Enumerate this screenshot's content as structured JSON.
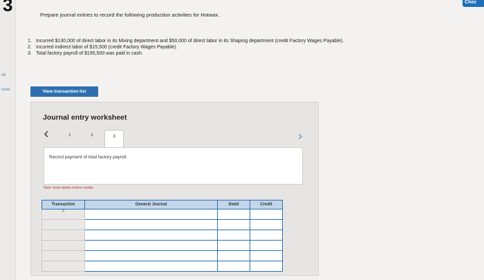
{
  "app": {
    "big_digit": "3",
    "side_labels": [
      "ok",
      "nces"
    ],
    "check_button": "Chec"
  },
  "question": {
    "prompt": "Prepare journal entries to record the following production activities for Hotwax.",
    "items": [
      {
        "num": "1.",
        "text": "Incurred $130,000 of direct labor in its Mixing department and $50,000 of direct labor in its Shaping department (credit Factory Wages Payable)."
      },
      {
        "num": "2.",
        "text": "Incurred indirect labor of $15,500 (credit Factory Wages Payable)."
      },
      {
        "num": "3.",
        "text": "Total factory payroll of $195,500 was paid in cash."
      }
    ]
  },
  "view_button": "View transaction list",
  "worksheet": {
    "title": "Journal entry worksheet",
    "prev_icon": "chevron-left-icon",
    "next_icon": "chevron-right-icon",
    "tabs": [
      "1",
      "2",
      "3"
    ],
    "active_tab": "3",
    "description": "Record payment of total factory payroll.",
    "note": "Note: Enter debits before credits.",
    "table": {
      "headers": [
        "Transaction",
        "General Journal",
        "Debit",
        "Credit"
      ],
      "rows": [
        [
          "3",
          "",
          "",
          ""
        ],
        [
          "",
          "",
          "",
          ""
        ],
        [
          "",
          "",
          "",
          ""
        ],
        [
          "",
          "",
          "",
          ""
        ],
        [
          "",
          "",
          "",
          ""
        ],
        [
          "",
          "",
          "",
          ""
        ]
      ]
    }
  }
}
